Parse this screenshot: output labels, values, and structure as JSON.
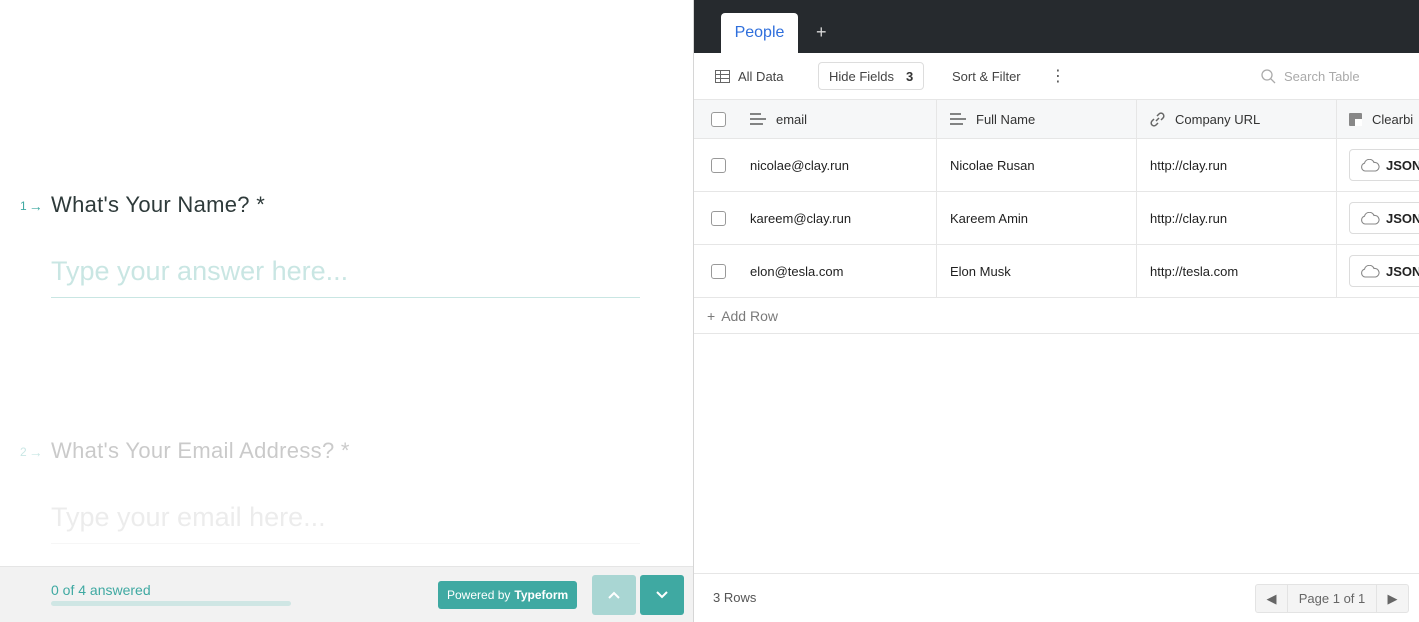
{
  "typeform": {
    "questions": [
      {
        "number": "1",
        "title": "What's Your Name? *",
        "placeholder": "Type your answer here..."
      },
      {
        "number": "2",
        "title": "What's Your Email Address? *",
        "placeholder": "Type your email here..."
      }
    ],
    "footer": {
      "progress_label": "0 of 4 answered",
      "progress_fraction": 0,
      "powered_prefix": "Powered by",
      "powered_brand": "Typeform"
    },
    "accent_color": "#3fa9a2"
  },
  "clay": {
    "tabs": [
      {
        "label": "People",
        "active": true
      }
    ],
    "add_tab_label": "+",
    "toolbar": {
      "view_label": "All Data",
      "hide_fields_label": "Hide Fields",
      "hide_fields_count": "3",
      "sort_filter_label": "Sort & Filter",
      "search_placeholder": "Search Table"
    },
    "columns": [
      {
        "label": "email",
        "icon": "text-lines-icon"
      },
      {
        "label": "Full Name",
        "icon": "text-lines-icon"
      },
      {
        "label": "Company URL",
        "icon": "link-icon"
      },
      {
        "label": "Clearbi",
        "icon": "clearbit-icon"
      }
    ],
    "rows": [
      {
        "email": "nicolae@clay.run",
        "full_name": "Nicolae Rusan",
        "company_url": "http://clay.run",
        "clearbit": "JSON"
      },
      {
        "email": "kareem@clay.run",
        "full_name": "Kareem Amin",
        "company_url": "http://clay.run",
        "clearbit": "JSON"
      },
      {
        "email": "elon@tesla.com",
        "full_name": "Elon Musk",
        "company_url": "http://tesla.com",
        "clearbit": "JSON"
      }
    ],
    "add_row_label": "Add Row",
    "footer": {
      "rows_count": "3 Rows",
      "page_label": "Page 1 of 1"
    },
    "accent_color": "#2f6fdc"
  }
}
